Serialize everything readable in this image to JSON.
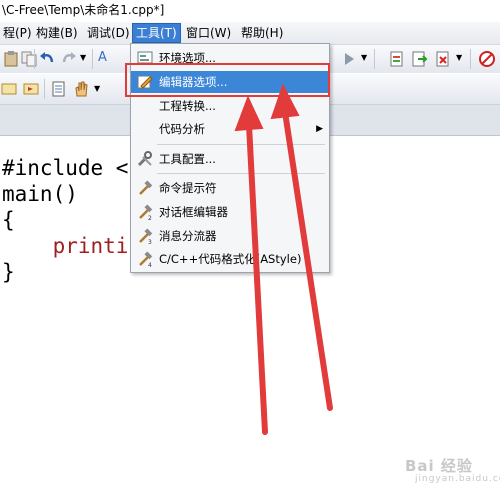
{
  "window": {
    "title": "\\C-Free\\Temp\\未命名1.cpp*]"
  },
  "menubar": {
    "items": [
      {
        "label": "程(P)"
      },
      {
        "label": "构建(B)"
      },
      {
        "label": "调试(D)"
      },
      {
        "label": "工具(T)"
      },
      {
        "label": "窗口(W)"
      },
      {
        "label": "帮助(H)"
      }
    ]
  },
  "tools_menu": {
    "items": [
      {
        "label": "环境选项..."
      },
      {
        "label": "编辑器选项..."
      },
      {
        "label": "工程转换..."
      },
      {
        "label": "代码分析"
      },
      {
        "label": "工具配置..."
      },
      {
        "label": "命令提示符"
      },
      {
        "label": "对话框编辑器"
      },
      {
        "label": "消息分流器"
      },
      {
        "label": "C/C++代码格式化(AStyle)"
      }
    ]
  },
  "editor": {
    "lines": [
      "#include <",
      "main()",
      "{",
      "    printi",
      "}"
    ]
  },
  "watermark": {
    "brand": "Bai 经验",
    "url": "jingyan.baidu.com"
  },
  "colors": {
    "accent": "#3c86d8",
    "annotation": "#e23b3b"
  }
}
